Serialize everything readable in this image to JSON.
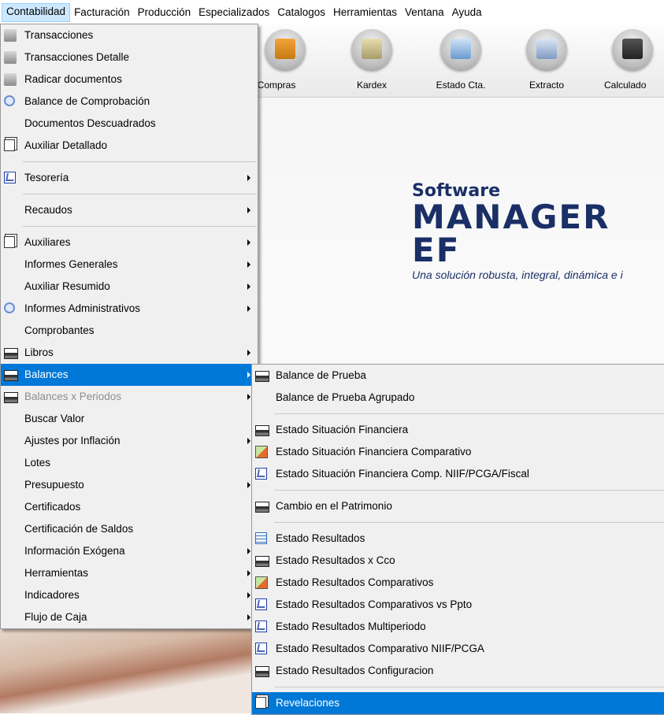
{
  "menubar": {
    "items": [
      "Contabilidad",
      "Facturación",
      "Producción",
      "Especializados",
      "Catalogos",
      "Herramientas",
      "Ventana",
      "Ayuda"
    ]
  },
  "toolbar": {
    "buttons": [
      {
        "label": "Compras",
        "icon": "truck-icon"
      },
      {
        "label": "Kardex",
        "icon": "kardex-icon"
      },
      {
        "label": "Estado Cta.",
        "icon": "id-card-icon"
      },
      {
        "label": "Extracto",
        "icon": "extract-icon"
      },
      {
        "label": "Calculado",
        "icon": "calculator-icon"
      }
    ]
  },
  "brand": {
    "small": "Software",
    "big": "MANAGER EF",
    "tagline": "Una solución robusta, integral, dinámica e i"
  },
  "main_menu": {
    "items": [
      {
        "label": "Transacciones",
        "icon": "transactions-icon"
      },
      {
        "label": "Transacciones Detalle",
        "icon": "transactions-icon"
      },
      {
        "label": "Radicar documentos",
        "icon": "transactions-icon"
      },
      {
        "label": "Balance de Comprobación",
        "icon": "magnifier-icon"
      },
      {
        "label": "Documentos Descuadrados",
        "icon": ""
      },
      {
        "label": "Auxiliar Detallado",
        "icon": "document-icon"
      },
      {
        "label": "Tesorería",
        "icon": "checklist-icon",
        "submenu": true
      },
      {
        "label": "Recaudos",
        "icon": "",
        "submenu": true
      },
      {
        "label": "Auxiliares",
        "icon": "document-icon",
        "submenu": true
      },
      {
        "label": "Informes Generales",
        "icon": "",
        "submenu": true
      },
      {
        "label": "Auxiliar Resumido",
        "icon": "",
        "submenu": true
      },
      {
        "label": "Informes Administrativos",
        "icon": "magnifier-icon",
        "submenu": true
      },
      {
        "label": "Comprobantes",
        "icon": ""
      },
      {
        "label": "Libros",
        "icon": "printer-icon",
        "submenu": true
      },
      {
        "label": "Balances",
        "icon": "printer-icon",
        "submenu": true
      },
      {
        "label": "Balances x Periodos",
        "icon": "printer-icon",
        "submenu": true
      },
      {
        "label": "Buscar Valor",
        "icon": ""
      },
      {
        "label": "Ajustes por Inflación",
        "icon": "",
        "submenu": true
      },
      {
        "label": "Lotes",
        "icon": ""
      },
      {
        "label": "Presupuesto",
        "icon": "",
        "submenu": true
      },
      {
        "label": "Certificados",
        "icon": ""
      },
      {
        "label": "Certificación de Saldos",
        "icon": ""
      },
      {
        "label": "Información Exógena",
        "icon": "",
        "submenu": true
      },
      {
        "label": "Herramientas",
        "icon": "",
        "submenu": true
      },
      {
        "label": "Indicadores",
        "icon": "",
        "submenu": true
      },
      {
        "label": "Flujo de Caja",
        "icon": "",
        "submenu": true
      }
    ],
    "highlighted": "Balances",
    "disabled": "Balances x Periodos"
  },
  "sub_menu": {
    "items": [
      {
        "label": "Balance de Prueba",
        "icon": "printer-icon"
      },
      {
        "label": "Balance de Prueba Agrupado",
        "icon": ""
      },
      {
        "label": "Estado Situación Financiera",
        "icon": "printer-icon"
      },
      {
        "label": "Estado Situación Financiera Comparativo",
        "icon": "compare-icon"
      },
      {
        "label": "Estado Situación Financiera Comp. NIIF/PCGA/Fiscal",
        "icon": "checklist-icon"
      },
      {
        "label": "Cambio en el Patrimonio",
        "icon": "printer-icon"
      },
      {
        "label": "Estado Resultados",
        "icon": "table-icon"
      },
      {
        "label": "Estado Resultados x Cco",
        "icon": "printer-icon"
      },
      {
        "label": "Estado Resultados Comparativos",
        "icon": "compare-icon"
      },
      {
        "label": "Estado Resultados Comparativos vs Ppto",
        "icon": "checklist-icon"
      },
      {
        "label": "Estado Resultados Multiperiodo",
        "icon": "checklist-icon"
      },
      {
        "label": "Estado Resultados Comparativo NIIF/PCGA",
        "icon": "checklist-icon"
      },
      {
        "label": "Estado Resultados Configuracion",
        "icon": "printer-icon"
      },
      {
        "label": "Revelaciones",
        "icon": "document-icon"
      }
    ],
    "highlighted": "Revelaciones"
  },
  "colors": {
    "highlight": "#0078d7",
    "brand": "#1a2f66",
    "menu_bg": "#f0f0f0"
  }
}
